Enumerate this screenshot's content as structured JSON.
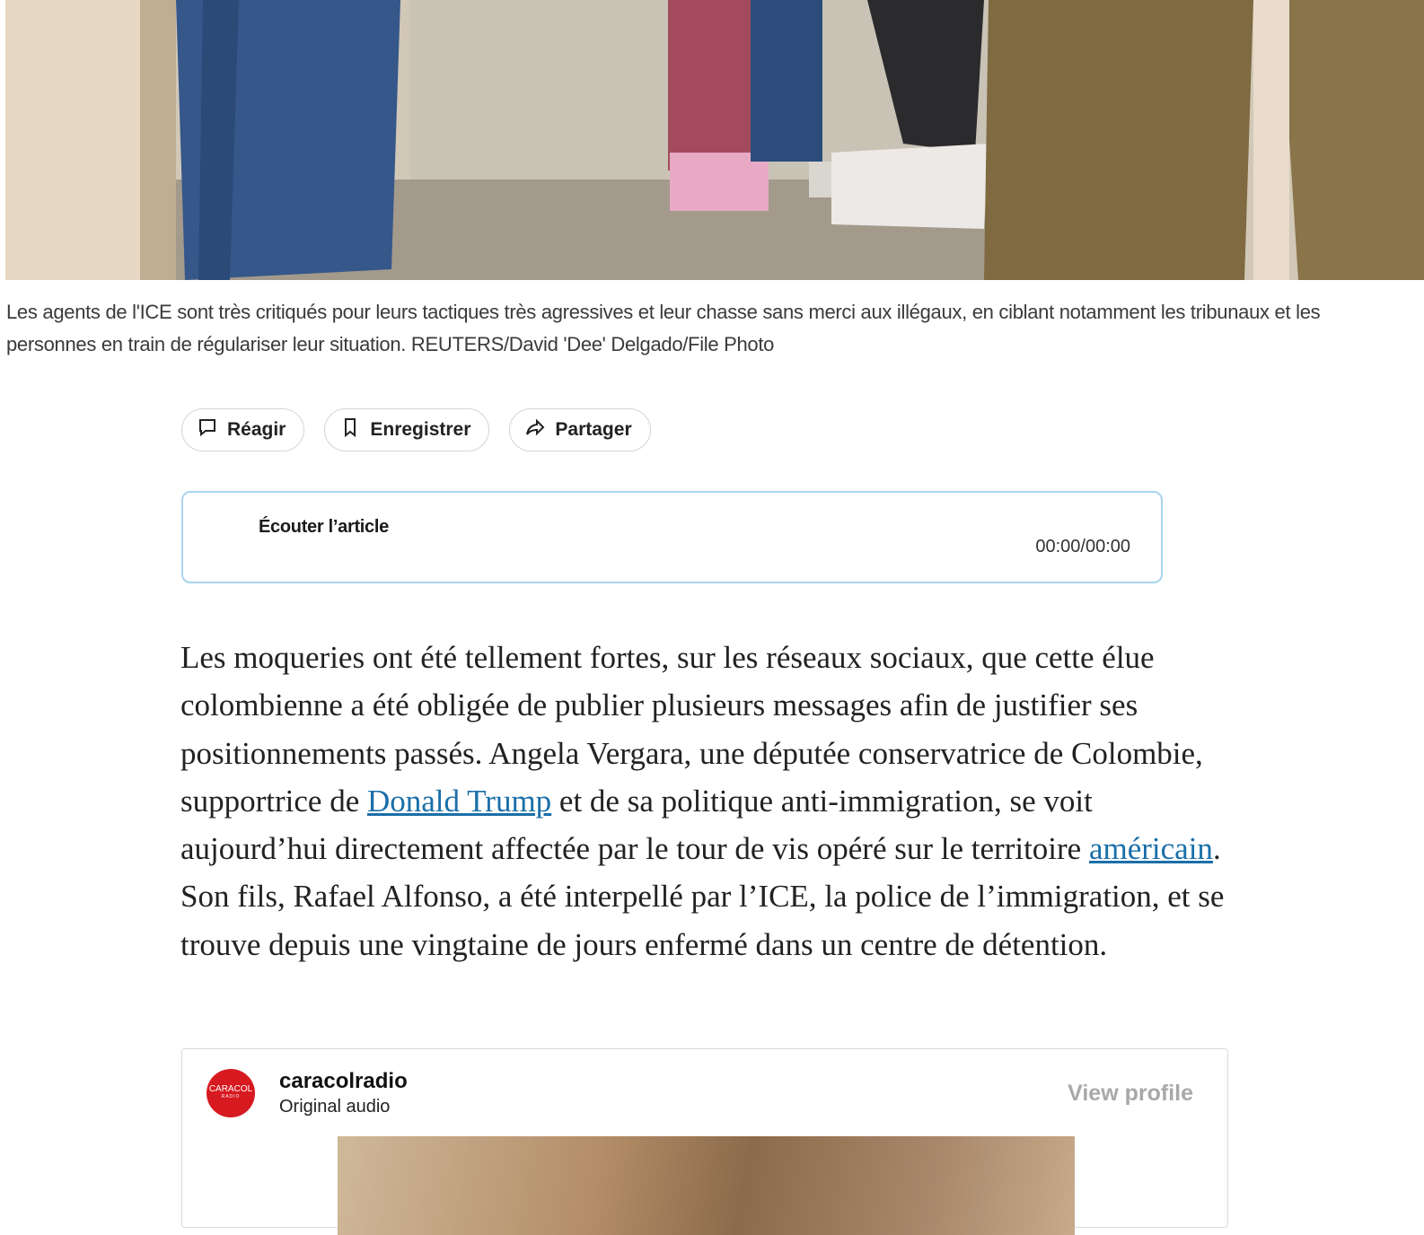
{
  "hero": {
    "caption": "Les agents de l'ICE sont très critiqués pour leurs tactiques très agressives et leur chasse sans merci aux illégaux, en ciblant notamment les tribunaux et les personnes en train de régulariser leur situation. REUTERS/David 'Dee' Delgado/File Photo"
  },
  "actions": {
    "react_label": "Réagir",
    "save_label": "Enregistrer",
    "share_label": "Partager"
  },
  "audio": {
    "title": "Écouter l’article",
    "time": "00:00/00:00"
  },
  "article": {
    "p1_a": "Les moqueries ont été tellement fortes, sur les réseaux sociaux, que cette élue colombienne a été obligée de publier plusieurs messages afin de justifier ses positionnements passés. Angela Vergara, une députée conservatrice de Colombie, supportrice de ",
    "link1": "Donald Trump",
    "p1_b": " et de sa politique anti-immigration, se voit aujourd’hui directement affectée par le tour de vis opéré sur le territoire ",
    "link2": "américain",
    "p1_c": ". Son fils, Rafael Alfonso, a été interpellé par l’ICE, la police de l’immigration, et se trouve depuis une vingtaine de jours enfermé dans un centre de détention."
  },
  "embed": {
    "avatar_text": "CARACOL",
    "avatar_sub": "RADIO",
    "username": "caracolradio",
    "subtitle": "Original audio",
    "view_profile": "View profile"
  }
}
